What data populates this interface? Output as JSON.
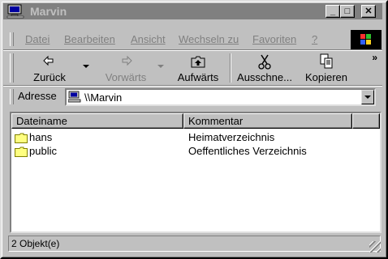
{
  "window": {
    "title": "Marvin"
  },
  "menu": {
    "items": [
      "Datei",
      "Bearbeiten",
      "Ansicht",
      "Wechseln zu",
      "Favoriten",
      "?"
    ]
  },
  "toolbar": {
    "back": "Zurück",
    "forward": "Vorwärts",
    "up": "Aufwärts",
    "cut": "Ausschne...",
    "copy": "Kopieren",
    "more": "»"
  },
  "address": {
    "label": "Adresse",
    "value": "\\\\Marvin"
  },
  "list": {
    "columns": [
      "Dateiname",
      "Kommentar"
    ],
    "rows": [
      {
        "name": "hans",
        "comment": "Heimatverzeichnis"
      },
      {
        "name": "public",
        "comment": "Oeffentliches Verzeichnis"
      }
    ]
  },
  "status": {
    "text": "2 Objekt(e)"
  },
  "colors": {
    "titlebar_inactive": "#808080",
    "face": "#c0c0c0",
    "desktop": "#008080",
    "folder": "#ffff80"
  }
}
